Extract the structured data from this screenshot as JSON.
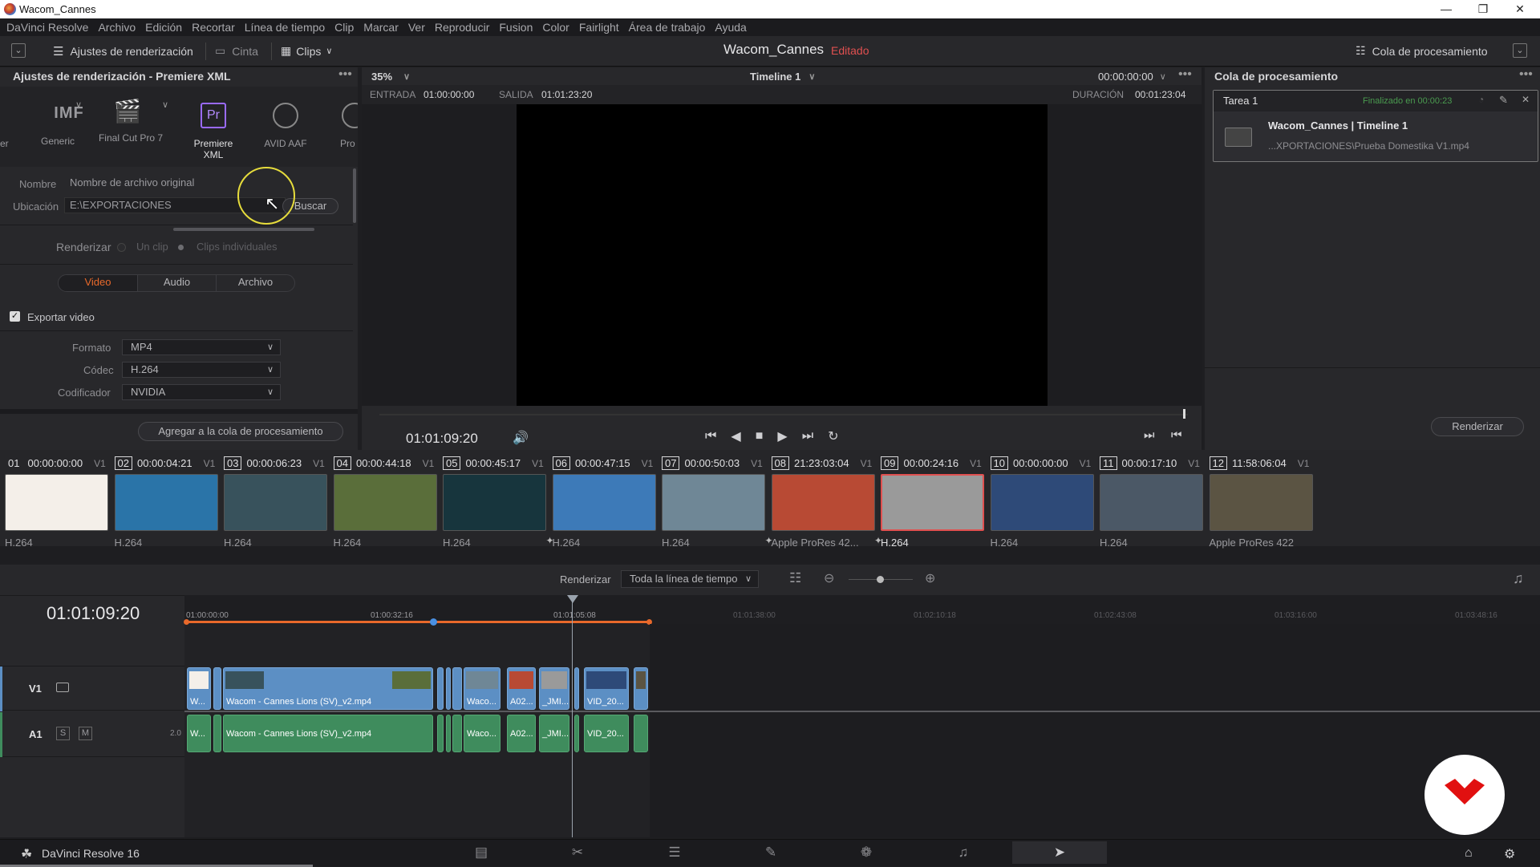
{
  "window": {
    "title": "Wacom_Cannes"
  },
  "menubar": [
    "DaVinci Resolve",
    "Archivo",
    "Edición",
    "Recortar",
    "Línea de tiempo",
    "Clip",
    "Marcar",
    "Ver",
    "Reproducir",
    "Fusion",
    "Color",
    "Fairlight",
    "Área de trabajo",
    "Ayuda"
  ],
  "toolbar": {
    "render_settings": "Ajustes de renderización",
    "tape": "Cinta",
    "clips": "Clips",
    "project": "Wacom_Cannes",
    "edited": "Editado",
    "render_queue": "Cola de procesamiento"
  },
  "render_settings": {
    "title": "Ajustes de renderización - Premiere XML",
    "presets": [
      {
        "icon": "IMF",
        "label": "Generic"
      },
      {
        "icon": "clapper-icon",
        "label": "Final Cut Pro 7"
      },
      {
        "icon": "Pr",
        "label": "Premiere XML"
      },
      {
        "icon": "avid-icon",
        "label": "AVID AAF"
      },
      {
        "icon": "pro-tools-icon",
        "label": "Pro T"
      }
    ],
    "left_edge_label": "er",
    "name_label": "Nombre",
    "name_value": "Nombre de archivo original",
    "location_label": "Ubicación",
    "location_value": "E:\\EXPORTACIONES",
    "browse": "Buscar",
    "render_label": "Renderizar",
    "render_single": "Un clip",
    "render_individual": "Clips individuales",
    "tabs": [
      "Video",
      "Audio",
      "Archivo"
    ],
    "export_video": "Exportar video",
    "format_label": "Formato",
    "format_value": "MP4",
    "codec_label": "Códec",
    "codec_value": "H.264",
    "encoder_label": "Codificador",
    "encoder_value": "NVIDIA",
    "add_to_queue": "Agregar a la cola de procesamiento"
  },
  "viewer": {
    "zoom": "35%",
    "timeline_name": "Timeline 1",
    "tc_top": "00:00:00:00",
    "in_label": "ENTRADA",
    "in_value": "01:00:00:00",
    "out_label": "SALIDA",
    "out_value": "01:01:23:20",
    "duration_label": "DURACIÓN",
    "duration_value": "00:01:23:04",
    "timecode": "01:01:09:20"
  },
  "queue": {
    "title": "Cola de procesamiento",
    "job_title": "Tarea 1",
    "job_status": "Finalizado en 00:00:23",
    "job_name": "Wacom_Cannes | Timeline 1",
    "job_path": "...XPORTACIONES\\Prueba Domestika V1.mp4",
    "render_button": "Renderizar"
  },
  "clips": [
    {
      "num": "01",
      "tc": "00:00:00:00",
      "track": "V1",
      "codec": "H.264",
      "thumb": "#f4efe9",
      "sel": false,
      "fx": false
    },
    {
      "num": "02",
      "tc": "00:00:04:21",
      "track": "V1",
      "codec": "H.264",
      "thumb": "#2a74a8",
      "sel": false,
      "fx": false
    },
    {
      "num": "03",
      "tc": "00:00:06:23",
      "track": "V1",
      "codec": "H.264",
      "thumb": "#38525c",
      "sel": false,
      "fx": false
    },
    {
      "num": "04",
      "tc": "00:00:44:18",
      "track": "V1",
      "codec": "H.264",
      "thumb": "#5a6e3a",
      "sel": false,
      "fx": false
    },
    {
      "num": "05",
      "tc": "00:00:45:17",
      "track": "V1",
      "codec": "H.264",
      "thumb": "#17353d",
      "sel": false,
      "fx": false
    },
    {
      "num": "06",
      "tc": "00:00:47:15",
      "track": "V1",
      "codec": "H.264",
      "thumb": "#3d7ab8",
      "sel": false,
      "fx": true
    },
    {
      "num": "07",
      "tc": "00:00:50:03",
      "track": "V1",
      "codec": "H.264",
      "thumb": "#6f8796",
      "sel": false,
      "fx": false
    },
    {
      "num": "08",
      "tc": "21:23:03:04",
      "track": "V1",
      "codec": "Apple ProRes 42...",
      "thumb": "#b84a34",
      "sel": false,
      "fx": true
    },
    {
      "num": "09",
      "tc": "00:00:24:16",
      "track": "V1",
      "codec": "H.264",
      "thumb": "#9a9a9a",
      "sel": true,
      "fx": true
    },
    {
      "num": "10",
      "tc": "00:00:00:00",
      "track": "V1",
      "codec": "H.264",
      "thumb": "#2e4a78",
      "sel": false,
      "fx": false
    },
    {
      "num": "11",
      "tc": "00:00:17:10",
      "track": "V1",
      "codec": "H.264",
      "thumb": "#4b5866",
      "sel": false,
      "fx": false
    },
    {
      "num": "12",
      "tc": "11:58:06:04",
      "track": "V1",
      "codec": "Apple ProRes 422",
      "thumb": "#5b5443",
      "sel": false,
      "fx": false
    }
  ],
  "timeline": {
    "render_label": "Renderizar",
    "render_range": "Toda la línea de tiempo",
    "timecode": "01:01:09:20",
    "ruler": [
      "01:00:00:00",
      "01:00:32:16",
      "01:01:05:08",
      "01:01:38:00",
      "01:02:10:18",
      "01:02:43:08",
      "01:03:16:00",
      "01:03:48:16"
    ],
    "v1": "V1",
    "a1": "A1",
    "solo": "S",
    "mute": "M",
    "channels": "2.0",
    "clip_main": "Wacom - Cannes Lions (SV)_v2.mp4",
    "clip_w": "W...",
    "clip_waco": "Waco...",
    "clip_a02": "A02...",
    "clip_jmi": "_JMI...",
    "clip_vid": "VID_20..."
  },
  "footer": {
    "app": "DaVinci Resolve 16"
  },
  "colors": {
    "accent": "#e8692b",
    "playhead": "#9aa3ad",
    "edited": "#e05050",
    "v_clip": "#5c8fc4",
    "a_clip": "#3f8c5d",
    "logo": "#e11010",
    "finished": "#4a9b4f"
  }
}
